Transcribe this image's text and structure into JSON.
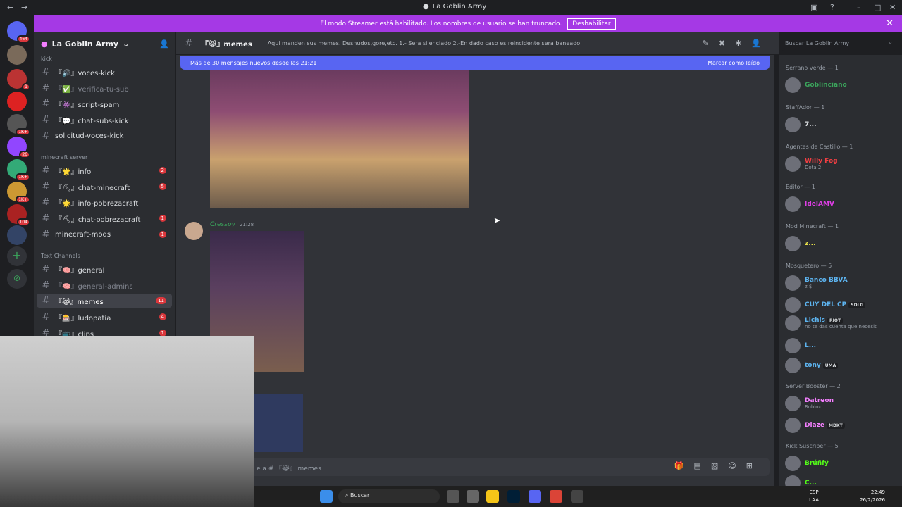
{
  "window": {
    "title": "La Goblin Army"
  },
  "banner": {
    "text": "El modo Streamer está habilitado. Los nombres de usuario se han truncado.",
    "button": "Deshabilitar"
  },
  "server_badges": [
    "464",
    "1",
    "1K+",
    "1K+",
    "26",
    "1K+",
    "104"
  ],
  "guild": {
    "name": "La Goblin Army"
  },
  "categories": {
    "kick": "kick",
    "minecraft": "minecraft server",
    "text": "Text Channels"
  },
  "channels": [
    {
      "label": "『🔊』voces-kick",
      "count": ""
    },
    {
      "label": "『✅』verifica-tu-sub",
      "count": ""
    },
    {
      "label": "『👾』script-spam",
      "count": ""
    },
    {
      "label": "『💬』chat-subs-kick",
      "count": ""
    },
    {
      "label": "solicitud-voces-kick",
      "count": ""
    },
    {
      "label": "『🌟』info",
      "count": "2"
    },
    {
      "label": "『⛏』chat-minecraft",
      "count": "5"
    },
    {
      "label": "『🌟』info-pobrezacraft",
      "count": ""
    },
    {
      "label": "『⛏』chat-pobrezacraft",
      "count": "1"
    },
    {
      "label": "minecraft-mods",
      "count": "1"
    },
    {
      "label": "『🧠』general",
      "count": ""
    },
    {
      "label": "『🧠』general-admins",
      "count": ""
    },
    {
      "label": "『😹』memes",
      "count": "11"
    },
    {
      "label": "『🎰』ludopatia",
      "count": "4"
    },
    {
      "label": "『📺』clips",
      "count": "1"
    }
  ],
  "chat": {
    "channel": "『😹』memes",
    "topic": "Aqui manden sus memes. Desnudos,gore,etc. 1.- Sera silenciado 2.-En dado caso es reincidente sera baneado",
    "new_messages": "Más de 30 mensajes nuevos desde las 21:21",
    "mark_read": "Marcar como leído",
    "author": "Cresspy",
    "time": "21:28",
    "composer_placeholder": "e a # 『😹』 memes"
  },
  "search": {
    "placeholder": "Buscar La Goblin Army"
  },
  "members": [
    {
      "group": "Serrano verde — 1",
      "name": "Goblinciano",
      "sub": "",
      "tag": "",
      "color": "#3ba55c"
    },
    {
      "group": "StaffAdor — 1",
      "name": "7...",
      "sub": "",
      "tag": "",
      "color": "#dbdee1"
    },
    {
      "group": "Agentes de Castillo — 1",
      "name": "Willy Fog",
      "sub": "Dota 2",
      "tag": "",
      "color": "#f23f43"
    },
    {
      "group": "Editor — 1",
      "name": "IdelAMV",
      "sub": "",
      "tag": "",
      "color": "#e03ee8"
    },
    {
      "group": "Mod Minecraft — 1",
      "name": "z...",
      "sub": "",
      "tag": "",
      "color": "#e8e04a"
    },
    {
      "group": "Mosquetero — 5",
      "name": "Banco BBVA",
      "sub": "z $",
      "tag": "",
      "color": "#5db4f0"
    },
    {
      "group": "",
      "name": "CUY DEL CP",
      "sub": "",
      "tag": "SDLG",
      "color": "#5db4f0"
    },
    {
      "group": "",
      "name": "Lichis",
      "sub": "no te das cuenta que necesit",
      "tag": "RIOT",
      "color": "#5db4f0"
    },
    {
      "group": "",
      "name": "L...",
      "sub": "",
      "tag": "",
      "color": "#5db4f0"
    },
    {
      "group": "",
      "name": "tony",
      "sub": "",
      "tag": "UMA",
      "color": "#5db4f0"
    },
    {
      "group": "Server Booster — 2",
      "name": "Datreon",
      "sub": "Roblox",
      "tag": "",
      "color": "#f47fff"
    },
    {
      "group": "",
      "name": "Diaze",
      "sub": "",
      "tag": "MDKT",
      "color": "#f47fff"
    },
    {
      "group": "Kick Suscriber — 5",
      "name": "Brúñfý",
      "sub": "",
      "tag": "",
      "color": "#53fc18"
    },
    {
      "group": "",
      "name": "C...",
      "sub": "",
      "tag": "",
      "color": "#53fc18"
    }
  ],
  "taskbar": {
    "search": "Buscar",
    "lang1": "ESP",
    "lang2": "LAA",
    "time": "22:49",
    "date": "26/2/2026"
  }
}
